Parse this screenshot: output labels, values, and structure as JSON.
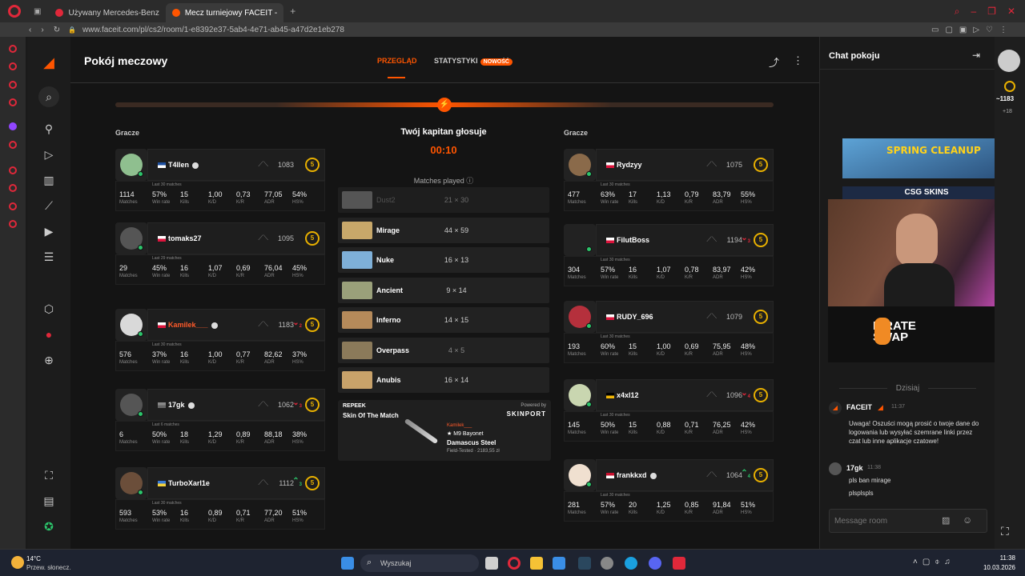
{
  "browser": {
    "tabs": [
      {
        "label": "Używany Mercedes-Benz"
      },
      {
        "label": "Mecz turniejowy FACEIT -"
      }
    ],
    "url": "www.faceit.com/pl/cs2/room/1-e8392e37-5ab4-4e71-ab45-a47d2e1eb278"
  },
  "header": {
    "title": "Pokój meczowy",
    "tab_overview": "PRZEGLĄD",
    "tab_stats": "STATYSTYKI",
    "tab_stats_badge": "NOWOŚĆ"
  },
  "left_team": {
    "label": "Gracze"
  },
  "right_team": {
    "label": "Gracze"
  },
  "vote": {
    "title": "Twój kapitan głosuje",
    "timer": "00:10",
    "matches_played": "Matches played"
  },
  "stat_labels": {
    "matches": "Matches",
    "winrate": "Win rate",
    "kills": "Kills",
    "kd": "K/D",
    "kr": "K/R",
    "adr": "ADR",
    "hs": "HS%"
  },
  "players_left": [
    {
      "name": "T4llen",
      "elo": "1083",
      "level": "5",
      "last": "Last 30 matches",
      "matches": "1114",
      "winrate": "57%",
      "kills": "15",
      "kd": "1,00",
      "kr": "0,73",
      "adr": "77,05",
      "hs": "54%"
    },
    {
      "name": "tomaks27",
      "elo": "1095",
      "level": "5",
      "last": "Last 29 matches",
      "matches": "29",
      "winrate": "45%",
      "kills": "16",
      "kd": "1,07",
      "kr": "0,69",
      "adr": "76,04",
      "hs": "45%"
    },
    {
      "name": "Kamilek___",
      "elo": "1183",
      "level": "5",
      "arrow_label": "2",
      "last": "Last 30 matches",
      "matches": "576",
      "winrate": "37%",
      "kills": "16",
      "kd": "1,00",
      "kr": "0,77",
      "adr": "82,62",
      "hs": "37%"
    },
    {
      "name": "17gk",
      "elo": "1062",
      "level": "5",
      "arrow_label": "3",
      "last": "Last 6 matches",
      "matches": "6",
      "winrate": "50%",
      "kills": "18",
      "kd": "1,29",
      "kr": "0,89",
      "adr": "88,18",
      "hs": "38%"
    },
    {
      "name": "TurboXarl1e",
      "elo": "1112",
      "level": "5",
      "arrow_label": "3",
      "last": "Last 30 matches",
      "matches": "593",
      "winrate": "53%",
      "kills": "16",
      "kd": "0,89",
      "kr": "0,71",
      "adr": "77,20",
      "hs": "51%"
    }
  ],
  "players_right": [
    {
      "name": "Rydzyy",
      "elo": "1075",
      "level": "5",
      "last": "Last 30 matches",
      "matches": "477",
      "winrate": "63%",
      "kills": "17",
      "kd": "1,13",
      "kr": "0,79",
      "adr": "83,79",
      "hs": "55%"
    },
    {
      "name": "FilutBoss",
      "elo": "1194",
      "level": "5",
      "arrow_label": "3",
      "last": "Last 30 matches",
      "matches": "304",
      "winrate": "57%",
      "kills": "16",
      "kd": "1,07",
      "kr": "0,78",
      "adr": "83,97",
      "hs": "42%"
    },
    {
      "name": "RUDY_696",
      "elo": "1079",
      "level": "5",
      "last": "Last 30 matches",
      "matches": "193",
      "winrate": "60%",
      "kills": "15",
      "kd": "1,00",
      "kr": "0,69",
      "adr": "75,95",
      "hs": "48%"
    },
    {
      "name": "x4xl12",
      "elo": "1096",
      "level": "5",
      "arrow_label": "4",
      "last": "Last 30 matches",
      "matches": "145",
      "winrate": "50%",
      "kills": "15",
      "kd": "0,88",
      "kr": "0,71",
      "adr": "76,25",
      "hs": "42%"
    },
    {
      "name": "frankkxd",
      "elo": "1064",
      "level": "5",
      "arrow_label": "4",
      "last": "Last 30 matches",
      "matches": "281",
      "winrate": "57%",
      "kills": "20",
      "kd": "1,25",
      "kr": "0,85",
      "adr": "91,84",
      "hs": "51%"
    }
  ],
  "maps": [
    {
      "name": "Dust2",
      "score": "21 × 30"
    },
    {
      "name": "Mirage",
      "score": "44 × 59"
    },
    {
      "name": "Nuke",
      "score": "16 × 13"
    },
    {
      "name": "Ancient",
      "score": "9 × 14"
    },
    {
      "name": "Inferno",
      "score": "14 × 15"
    },
    {
      "name": "Overpass",
      "score": "4 × 5"
    },
    {
      "name": "Anubis",
      "score": "16 × 14"
    }
  ],
  "skin": {
    "brand": "REPEEK",
    "title": "Skin Of The Match",
    "powered": "Powered by",
    "sponsor": "SKINPORT",
    "owner": "Kamilek___",
    "item1": "★ M9 Bayonet",
    "item2": "Damascus Steel",
    "cond": "Field-Tested · 2183,55 zł"
  },
  "chat": {
    "title": "Chat pokoju",
    "today": "Dzisiaj",
    "msg1_author": "FACEIT",
    "msg1_time": "11:37",
    "msg1_text": "Uwaga! Oszuści mogą prosić o twoje dane do logowania lub wysyłać szemrane linki przez czat lub inne aplikacje czatowe!",
    "msg2_author": "17gk",
    "msg2_time": "11:38",
    "msg2_line1": "pls ban mirage",
    "msg2_line2": "plsplspls",
    "placeholder": "Message room"
  },
  "overlay": {
    "banner": "SPRING CLEANUP",
    "csgo": "CSG SKINS",
    "pirate": "PIRATE SWAP"
  },
  "rail": {
    "elo": "~1183",
    "plus": "+18"
  },
  "taskbar": {
    "weather_temp": "14°C",
    "weather_desc": "Przew. słonecz.",
    "search": "Wyszukaj",
    "time": "11:38",
    "date": "10.03.2026"
  }
}
